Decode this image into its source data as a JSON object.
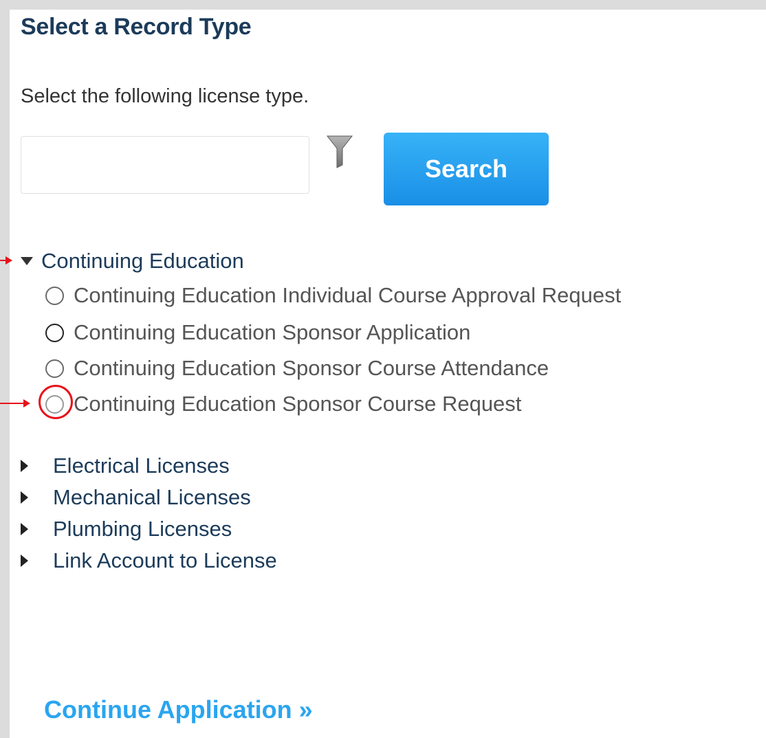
{
  "page": {
    "title": "Select a Record Type",
    "instruction": "Select the following license type."
  },
  "search": {
    "value": "",
    "placeholder": "",
    "button_label": "Search",
    "filter_icon": "filter-icon"
  },
  "expanded_category": {
    "label": "Continuing Education",
    "options": [
      {
        "label": "Continuing Education Individual Course Approval Request",
        "selected": false
      },
      {
        "label": "Continuing Education Sponsor Application",
        "selected": false
      },
      {
        "label": "Continuing Education Sponsor Course Attendance",
        "selected": false
      },
      {
        "label": "Continuing Education Sponsor Course Request",
        "selected": false
      }
    ]
  },
  "collapsed_categories": [
    {
      "label": "Electrical Licenses"
    },
    {
      "label": "Mechanical Licenses"
    },
    {
      "label": "Plumbing Licenses"
    },
    {
      "label": "Link Account to License"
    }
  ],
  "footer": {
    "continue_label": "Continue Application »"
  },
  "colors": {
    "title": "#1c3b5a",
    "button": "#1a8fe6",
    "link": "#2aa5f0",
    "annotation": "#e8121a"
  }
}
